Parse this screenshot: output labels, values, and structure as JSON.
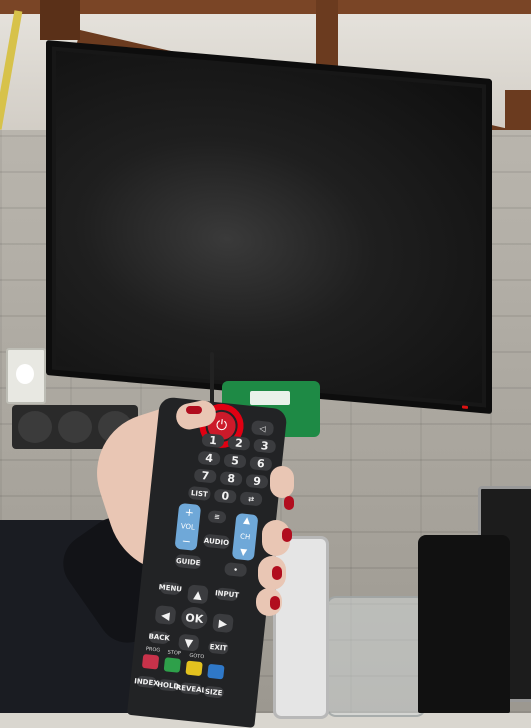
{
  "scene": {
    "description_icons": [
      "tv-icon",
      "remote-icon"
    ],
    "colors": {
      "power_highlight": "#e00012",
      "volume_rocker": "#6fa8d8",
      "nail_polish": "#b10d1e"
    }
  },
  "remote": {
    "power_symbol": "⏻",
    "mute_symbol": "🔇",
    "digits": [
      "1",
      "2",
      "3",
      "4",
      "5",
      "6",
      "7",
      "8",
      "9",
      "0"
    ],
    "list_label": "LIST",
    "vol_label": "VOL",
    "ch_label": "CH",
    "audio_label": "AUDIO",
    "guide_label": "GUIDE",
    "menu_label": "MENU",
    "input_label": "INPUT",
    "ok_label": "OK",
    "back_label": "BACK",
    "exit_label": "EXIT",
    "plus": "+",
    "minus": "−",
    "up": "▲",
    "down": "▼",
    "left": "◀",
    "right": "▶",
    "color_labels": [
      "PROG",
      "STOP",
      "GOTO",
      ""
    ],
    "bottom_labels": [
      "INDEX",
      "HOLD",
      "REVEAL",
      "SIZE"
    ]
  }
}
